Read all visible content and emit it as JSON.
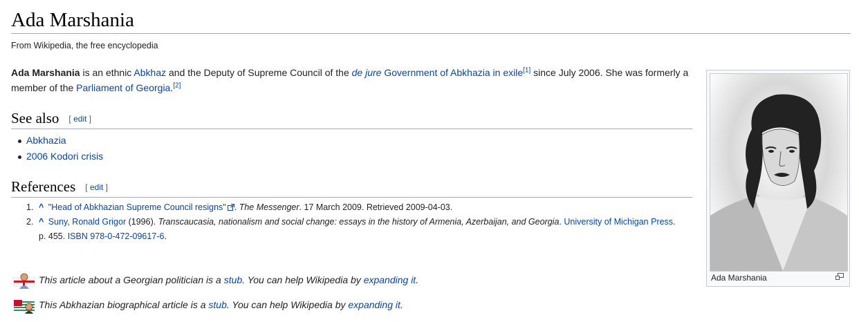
{
  "article": {
    "title": "Ada Marshania",
    "tagline": "From Wikipedia, the free encyclopedia"
  },
  "intro": {
    "subject": "Ada Marshania",
    "t1": " is an ethnic ",
    "link_abkhaz": "Abkhaz",
    "t2": " and the Deputy of Supreme Council of the ",
    "link_gov_italic": "de jure",
    "link_gov_rest": " Government of Abkhazia in exile",
    "ref1": "[1]",
    "t3": " since July 2006. She was formerly a member of the ",
    "link_parliament": "Parliament of Georgia",
    "t4": ".",
    "ref2": "[2]"
  },
  "see_also": {
    "heading": "See also",
    "edit_open": "[",
    "edit_label": "edit",
    "edit_close": "]",
    "items": [
      "Abkhazia",
      "2006 Kodori crisis"
    ]
  },
  "references": {
    "heading": "References",
    "edit_open": "[",
    "edit_label": "edit",
    "edit_close": "]",
    "items": [
      {
        "num": "1.",
        "caret": "^",
        "link": "\"Head of Abkhazian Supreme Council resigns\"",
        "t1": ". ",
        "italic": "The Messenger",
        "t2": ". 17 March 2009. Retrieved 2009-04-03."
      },
      {
        "num": "2.",
        "caret": "^",
        "author_link": "Suny, Ronald Grigor",
        "t1": " (1996). ",
        "italic": "Transcaucasia, nationalism and social change: essays in the history of Armenia, Azerbaijan, and Georgia",
        "t2": ". ",
        "publisher_link": "University of Michigan Press",
        "t3": ". p. 455. ",
        "isbn_link": "ISBN",
        "t4": " ",
        "isbn_num_link": "978-0-472-09617-6",
        "t5": "."
      }
    ]
  },
  "infobox": {
    "caption": "Ada Marshania"
  },
  "stubs": [
    {
      "t1": "This article about a Georgian politician is a ",
      "stub_link": "stub",
      "t2": ". You can help Wikipedia by ",
      "expand_link": "expanding it",
      "t3": "."
    },
    {
      "t1": "This Abkhazian biographical article is a ",
      "stub_link": "stub",
      "t2": ". You can help Wikipedia by ",
      "expand_link": "expanding it",
      "t3": "."
    }
  ],
  "colors": {
    "link": "#0645ad",
    "text": "#222222",
    "rule": "#a2a9b1"
  }
}
